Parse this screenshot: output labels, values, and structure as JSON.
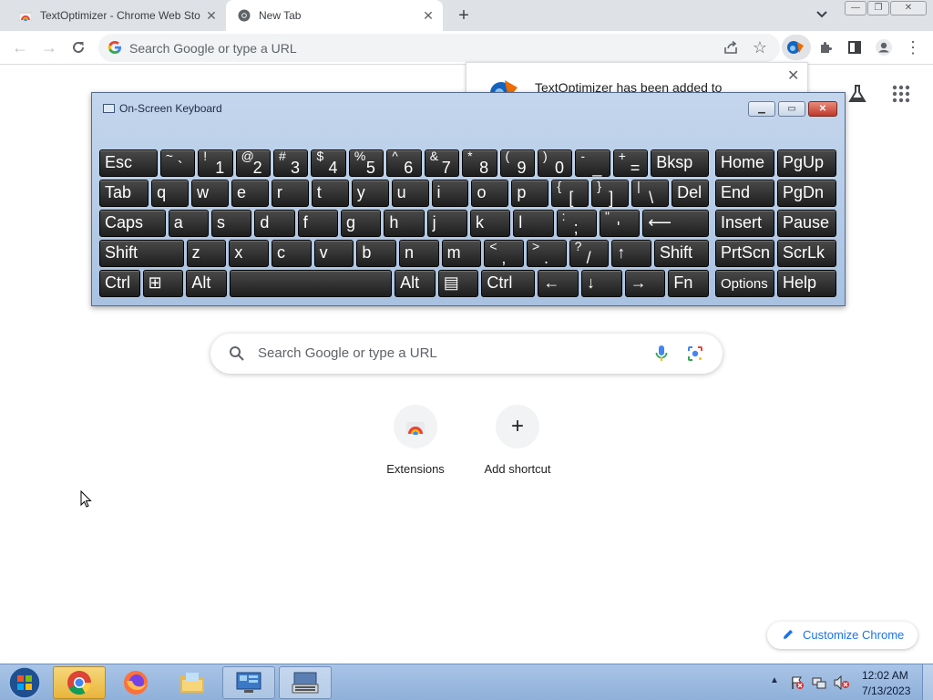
{
  "browser": {
    "tabs": [
      {
        "title": "TextOptimizer - Chrome Web Sto",
        "favicon": "chrome-web-store-icon",
        "active": false
      },
      {
        "title": "New Tab",
        "favicon": "chrome-icon",
        "active": true
      }
    ],
    "omnibox_placeholder": "Search Google or type a URL",
    "notification": {
      "text": "TextOptimizer has been added to"
    }
  },
  "osk": {
    "title": "On-Screen Keyboard",
    "rows": [
      [
        {
          "label": "Esc",
          "w": 1
        },
        {
          "top": "~",
          "bottom": "`",
          "w": 0.62
        },
        {
          "top": "!",
          "bottom": "1",
          "w": 0.62
        },
        {
          "top": "@",
          "bottom": "2",
          "w": 0.62
        },
        {
          "top": "#",
          "bottom": "3",
          "w": 0.62
        },
        {
          "top": "$",
          "bottom": "4",
          "w": 0.62
        },
        {
          "top": "%",
          "bottom": "5",
          "w": 0.62
        },
        {
          "top": "^",
          "bottom": "6",
          "w": 0.62
        },
        {
          "top": "&",
          "bottom": "7",
          "w": 0.62
        },
        {
          "top": "*",
          "bottom": "8",
          "w": 0.62
        },
        {
          "top": "(",
          "bottom": "9",
          "w": 0.62
        },
        {
          "top": ")",
          "bottom": "0",
          "w": 0.62
        },
        {
          "top": "-",
          "bottom": "_",
          "w": 0.62
        },
        {
          "top": "+",
          "bottom": "=",
          "w": 0.62
        },
        {
          "label": "Bksp",
          "w": 1
        }
      ],
      [
        {
          "label": "Tab",
          "w": 1.3
        },
        {
          "label": "q"
        },
        {
          "label": "w"
        },
        {
          "label": "e"
        },
        {
          "label": "r"
        },
        {
          "label": "t"
        },
        {
          "label": "y"
        },
        {
          "label": "u"
        },
        {
          "label": "i"
        },
        {
          "label": "o"
        },
        {
          "label": "p"
        },
        {
          "top": "{",
          "bottom": "["
        },
        {
          "top": "}",
          "bottom": "]"
        },
        {
          "top": "|",
          "bottom": "\\"
        },
        {
          "label": "Del"
        }
      ],
      [
        {
          "label": "Caps",
          "w": 1.6
        },
        {
          "label": "a"
        },
        {
          "label": "s"
        },
        {
          "label": "d"
        },
        {
          "label": "f"
        },
        {
          "label": "g"
        },
        {
          "label": "h"
        },
        {
          "label": "j"
        },
        {
          "label": "k"
        },
        {
          "label": "l"
        },
        {
          "top": ":",
          "bottom": ";"
        },
        {
          "top": "\"",
          "bottom": "'"
        },
        {
          "label": "⟵",
          "w": 1.6
        }
      ],
      [
        {
          "label": "Shift",
          "w": 2.05
        },
        {
          "label": "z"
        },
        {
          "label": "x"
        },
        {
          "label": "c"
        },
        {
          "label": "v"
        },
        {
          "label": "b"
        },
        {
          "label": "n"
        },
        {
          "label": "m"
        },
        {
          "top": "<",
          "bottom": ","
        },
        {
          "top": ">",
          "bottom": "."
        },
        {
          "top": "?",
          "bottom": "/"
        },
        {
          "label": "↑"
        },
        {
          "label": "Shift",
          "w": 1.35
        }
      ],
      [
        {
          "label": "Ctrl"
        },
        {
          "label": "⊞"
        },
        {
          "label": "Alt"
        },
        {
          "label": " ",
          "w": 3.8
        },
        {
          "label": "Alt"
        },
        {
          "label": "▤"
        },
        {
          "label": "Ctrl",
          "w": 1.3
        },
        {
          "label": "←"
        },
        {
          "label": "↓"
        },
        {
          "label": "→"
        },
        {
          "label": "Fn"
        }
      ]
    ],
    "side_keys": [
      [
        "Home",
        "PgUp"
      ],
      [
        "End",
        "PgDn"
      ],
      [
        "Insert",
        "Pause"
      ],
      [
        "PrtScn",
        "ScrLk"
      ],
      [
        "Options",
        "Help"
      ]
    ]
  },
  "ntp": {
    "search_placeholder": "Search Google or type a URL",
    "shortcuts": [
      {
        "label": "Extensions",
        "icon": "chrome-web-store-icon"
      },
      {
        "label": "Add shortcut",
        "icon": "plus-icon"
      }
    ],
    "customize_label": "Customize Chrome"
  },
  "taskbar": {
    "apps": [
      "chrome-icon",
      "firefox-icon",
      "explorer-icon",
      "control-panel-icon",
      "on-screen-keyboard-icon"
    ],
    "clock_time": "12:02 AM",
    "clock_date": "7/13/2023"
  },
  "colors": {
    "accent": "#1a73e8",
    "tabstrip": "#dee1e6",
    "taskbar": "#9bb8de"
  }
}
